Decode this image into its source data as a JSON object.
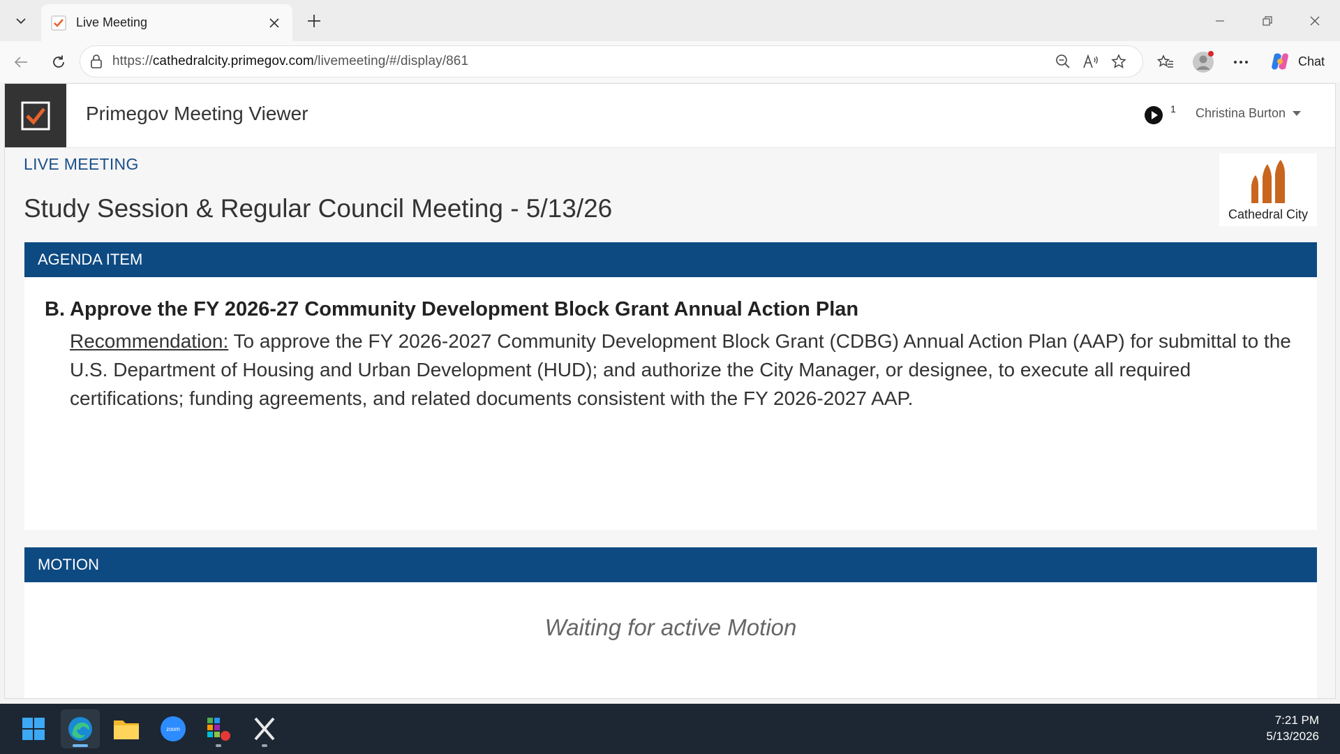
{
  "browser": {
    "tab": {
      "title": "Live Meeting"
    },
    "url": {
      "prefix": "https://",
      "domain": "cathedralcity.primegov.com",
      "path": "/livemeeting/#/display/861"
    },
    "chat_label": "Chat"
  },
  "app": {
    "title": "Primegov Meeting Viewer",
    "play_count": "1",
    "user_name": "Christina Burton"
  },
  "meeting": {
    "status_label": "LIVE MEETING",
    "title": "Study Session & Regular Council Meeting - 5/13/26",
    "city_logo_text": "Cathedral City"
  },
  "agenda": {
    "header": "AGENDA ITEM",
    "item_letter": "B.",
    "item_title": "Approve the FY 2026-27 Community Development Block Grant Annual Action Plan",
    "recommendation_label": "Recommendation:",
    "recommendation_text": " To approve the FY 2026-2027 Community Development Block Grant (CDBG) Annual Action Plan (AAP) for submittal to the U.S. Department of Housing and Urban Development (HUD); and authorize the City Manager, or designee, to execute all required certifications; funding agreements, and related documents consistent with the FY 2026-2027 AAP."
  },
  "motion": {
    "header": "MOTION",
    "message": "Waiting for active Motion"
  },
  "taskbar": {
    "apps": [
      "start-icon",
      "edge-icon",
      "file-explorer-icon",
      "zoom-icon",
      "app-grid-icon",
      "x-icon"
    ],
    "time": "7:21 PM",
    "date": "5/13/2026"
  },
  "colors": {
    "header_blue": "#0e4a82",
    "live_label_blue": "#1a4f8a",
    "check_orange": "#e8632c",
    "taskbar": "#1c2733"
  }
}
